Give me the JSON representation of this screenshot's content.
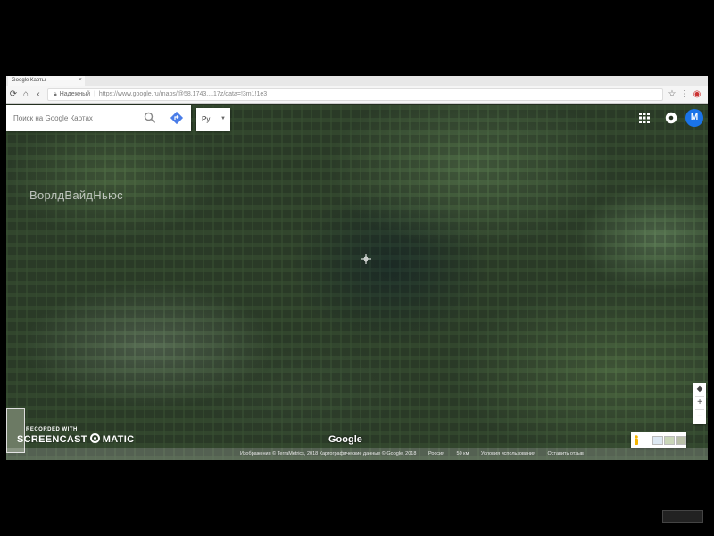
{
  "browser": {
    "tab_title": "Google Карты",
    "security_label": "Надежный",
    "url": "https://www.google.ru/maps/@58.1743",
    "url_tail": "...,17z/data=!3m1!1e3"
  },
  "map": {
    "search_placeholder": "Поиск на Google Картах",
    "language_selector": "Ру",
    "avatar_initial": "M",
    "watermark": "ВорлдВайдНьюс",
    "google_logo": "Google",
    "recorder": {
      "top": "RECORDED WITH",
      "left": "SCREENCAST",
      "right": "MATIC"
    },
    "attribution": {
      "imagery": "Изображения © TerraMetrics, 2018 Картографические данные © Google, 2018",
      "country": "Россия",
      "scale": "50 км",
      "terms": "Условия использования",
      "feedback": "Оставить отзыв"
    }
  },
  "colors": {
    "accent": "#1a73e8",
    "map_base": "#2a3a27"
  },
  "icons": [
    "back-icon",
    "reload-icon",
    "home-icon",
    "search-icon",
    "directions-icon",
    "apps-icon",
    "settings-icon",
    "crosshair-icon",
    "pegman-icon",
    "star-icon",
    "menu-icon"
  ]
}
